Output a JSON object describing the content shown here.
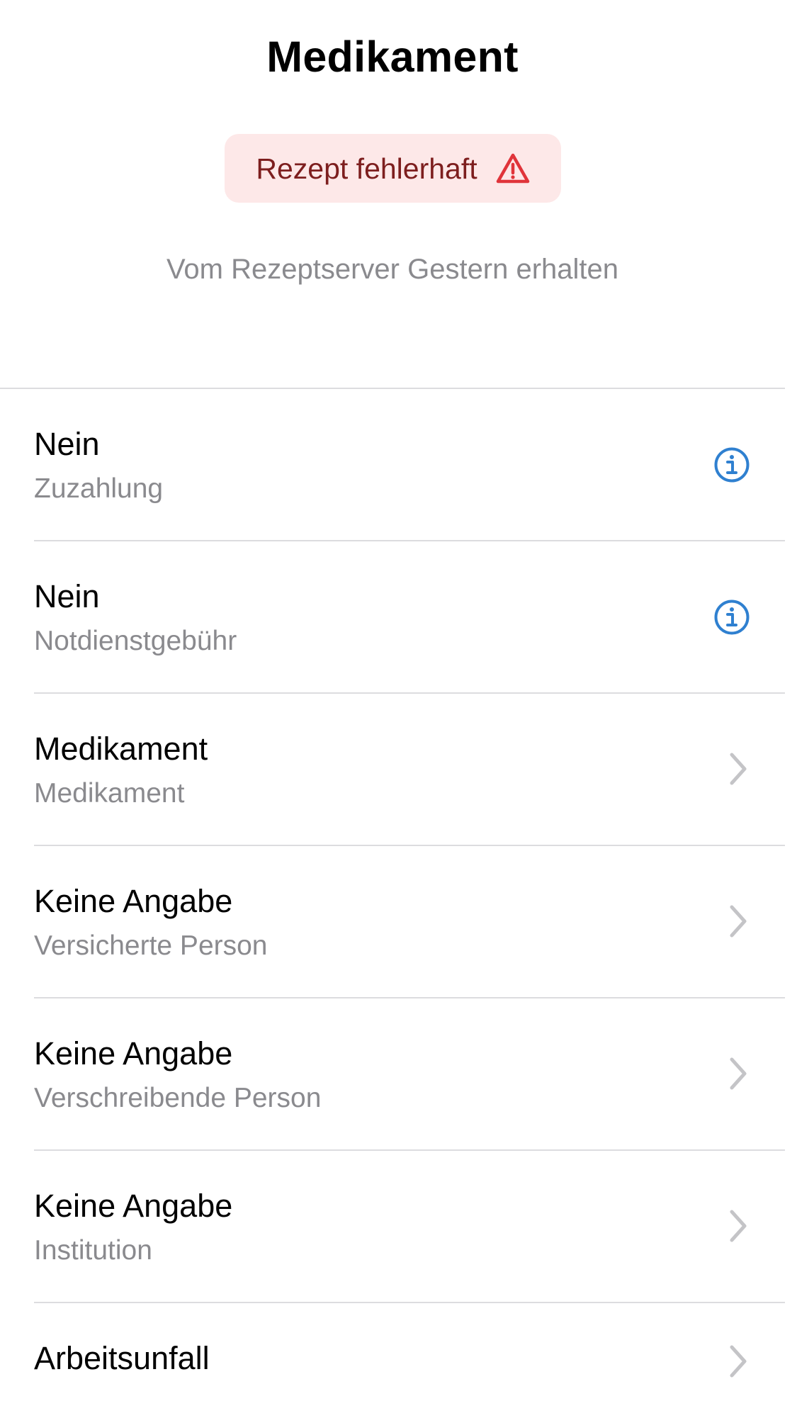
{
  "header": {
    "title": "Medikament"
  },
  "status": {
    "label": "Rezept fehlerhaft",
    "icon": "warning-icon",
    "background": "#fde8e8",
    "text_color": "#7d1e1e",
    "icon_color": "#e0343a"
  },
  "subtitle": "Vom Rezeptserver Gestern erhalten",
  "rows": [
    {
      "value": "Nein",
      "label": "Zuzahlung",
      "icon": "info-icon"
    },
    {
      "value": "Nein",
      "label": "Notdienstgebühr",
      "icon": "info-icon"
    },
    {
      "value": "Medikament",
      "label": "Medikament",
      "icon": "chevron-right-icon"
    },
    {
      "value": "Keine Angabe",
      "label": "Versicherte Person",
      "icon": "chevron-right-icon"
    },
    {
      "value": "Keine Angabe",
      "label": "Verschreibende Person",
      "icon": "chevron-right-icon"
    },
    {
      "value": "Keine Angabe",
      "label": "Institution",
      "icon": "chevron-right-icon"
    },
    {
      "value": "Arbeitsunfall",
      "label": "",
      "icon": "chevron-right-icon"
    }
  ],
  "colors": {
    "accent": "#2f80d0",
    "chevron": "#c4c4c7",
    "secondary_text": "#8a8a8e",
    "divider": "#dcdcdf"
  }
}
